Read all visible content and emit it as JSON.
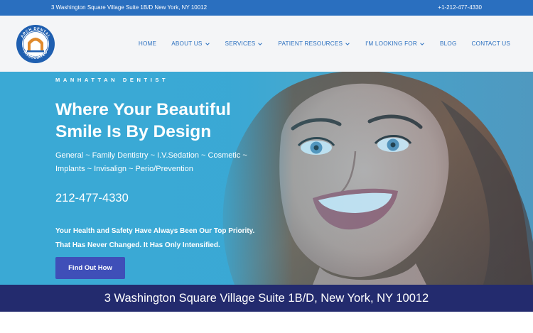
{
  "topbar": {
    "address": "3 Washington Square Village Suite 1B/D New York, NY 10012",
    "phone": "+1-212-477-4330"
  },
  "logo": {
    "text": "ARCH DENTAL ASSOCIATES",
    "colors": {
      "ring": "#1f5fb0",
      "inner": "#ffffff",
      "arch": "#e08a2c"
    }
  },
  "nav": {
    "items": [
      {
        "label": "HOME",
        "dropdown": false
      },
      {
        "label": "ABOUT US",
        "dropdown": true
      },
      {
        "label": "SERVICES",
        "dropdown": true
      },
      {
        "label": "PATIENT RESOURCES",
        "dropdown": true
      },
      {
        "label": "I'M LOOKING FOR",
        "dropdown": true
      },
      {
        "label": "BLOG",
        "dropdown": false
      },
      {
        "label": "CONTACT US",
        "dropdown": false
      }
    ],
    "chevron_icon": "chevron-down-icon"
  },
  "hero": {
    "eyebrow": "MANHATTAN DENTIST",
    "headline": "Where Your Beautiful Smile Is By Design",
    "services": "General ~ Family Dentistry ~ I.V.Sedation ~ Cosmetic ~ Implants ~ Invisalign ~ Perio/Prevention",
    "phone": "212-477-4330",
    "tagline": "Your Health and Safety Have Always Been Our Top Priority. That Has Never Changed. It Has Only Intensified.",
    "cta_label": "Find Out How"
  },
  "address_bar": {
    "text": "3 Washington Square Village Suite 1B/D, New York, NY 10012"
  },
  "colors": {
    "topbar": "#2a6fbf",
    "nav_text": "#2a6fbf",
    "hero_bg": "#3aa9d5",
    "cta": "#3f4fb8",
    "address_bar": "#232b6e"
  }
}
